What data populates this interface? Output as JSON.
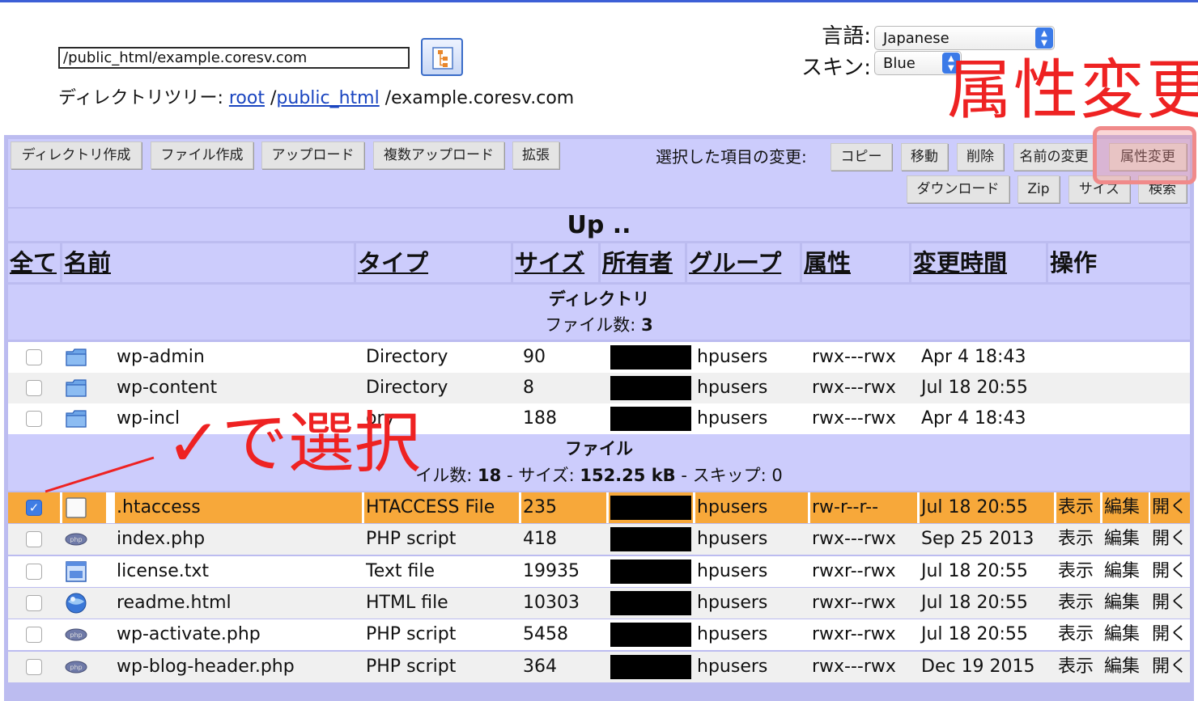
{
  "header": {
    "path_value": "/public_html/example.coresv.com",
    "breadcrumb_prefix": "ディレクトリツリー:",
    "crumbs": [
      "root",
      "public_html"
    ],
    "crumb_last": "/example.coresv.com",
    "lang_label": "言語:",
    "lang_value": "Japanese",
    "skin_label": "スキン:",
    "skin_value": "Blue"
  },
  "annotations": {
    "attr_change": "属性変更",
    "select_with_check": "✓で選択"
  },
  "toolbar": {
    "make_dir": "ディレクトリ作成",
    "make_file": "ファイル作成",
    "upload": "アップロード",
    "multi_upload": "複数アップロード",
    "extend": "拡張",
    "selected_label": "選択した項目の変更:",
    "copy": "コピー",
    "move": "移動",
    "delete": "削除",
    "rename": "名前の変更",
    "chmod": "属性変更",
    "download": "ダウンロード",
    "zip": "Zip",
    "size": "サイズ",
    "search": "検索"
  },
  "up_label": "Up ..",
  "columns": {
    "all": "全て",
    "name": "名前",
    "type": "タイプ",
    "size": "サイズ",
    "owner": "所有者",
    "group": "グループ",
    "perm": "属性",
    "mtime": "変更時間",
    "ops": "操作"
  },
  "dir_section": {
    "title": "ディレクトリ",
    "count_label": "ファイル数:",
    "count": "3"
  },
  "file_section": {
    "title": "ファイル",
    "count_label": "イル数:",
    "count": "18",
    "size_label": "- サイズ:",
    "size": "152.25 kB",
    "skip_label": "- スキップ: 0"
  },
  "directories": [
    {
      "name": "wp-admin",
      "type": "Directory",
      "size": "90",
      "group": "hpusers",
      "perm": "rwx---rwx",
      "mtime": "Apr 4 18:43"
    },
    {
      "name": "wp-content",
      "type": "Directory",
      "size": "8",
      "group": "hpusers",
      "perm": "rwx---rwx",
      "mtime": "Jul 18 20:55"
    },
    {
      "name": "wp-incl",
      "type": "ory",
      "size": "188",
      "group": "hpusers",
      "perm": "rwx---rwx",
      "mtime": "Apr 4 18:43"
    }
  ],
  "files": [
    {
      "name": ".htaccess",
      "type": "HTACCESS File",
      "size": "235",
      "group": "hpusers",
      "perm": "rw-r--r--",
      "mtime": "Jul 18 20:55",
      "icon": "blank-file-icon",
      "checked": true
    },
    {
      "name": "index.php",
      "type": "PHP script",
      "size": "418",
      "group": "hpusers",
      "perm": "rwx---rwx",
      "mtime": "Sep 25 2013",
      "icon": "php-icon",
      "checked": false
    },
    {
      "name": "license.txt",
      "type": "Text file",
      "size": "19935",
      "group": "hpusers",
      "perm": "rwxr--rwx",
      "mtime": "Jul 18 20:55",
      "icon": "text-file-icon",
      "checked": false
    },
    {
      "name": "readme.html",
      "type": "HTML file",
      "size": "10303",
      "group": "hpusers",
      "perm": "rwxr--rwx",
      "mtime": "Jul 18 20:55",
      "icon": "globe-icon",
      "checked": false
    },
    {
      "name": "wp-activate.php",
      "type": "PHP script",
      "size": "5458",
      "group": "hpusers",
      "perm": "rwxr--rwx",
      "mtime": "Jul 18 20:55",
      "icon": "php-icon",
      "checked": false
    },
    {
      "name": "wp-blog-header.php",
      "type": "PHP script",
      "size": "364",
      "group": "hpusers",
      "perm": "rwx---rwx",
      "mtime": "Dec 19 2015",
      "icon": "php-icon",
      "checked": false
    }
  ],
  "actions": {
    "view": "表示",
    "edit": "編集",
    "open": "開く"
  },
  "colors": {
    "accent": "#3d5fd6",
    "panel": "#ccccfc",
    "selected_row": "#f7a83a",
    "annotation": "#ee2222"
  }
}
